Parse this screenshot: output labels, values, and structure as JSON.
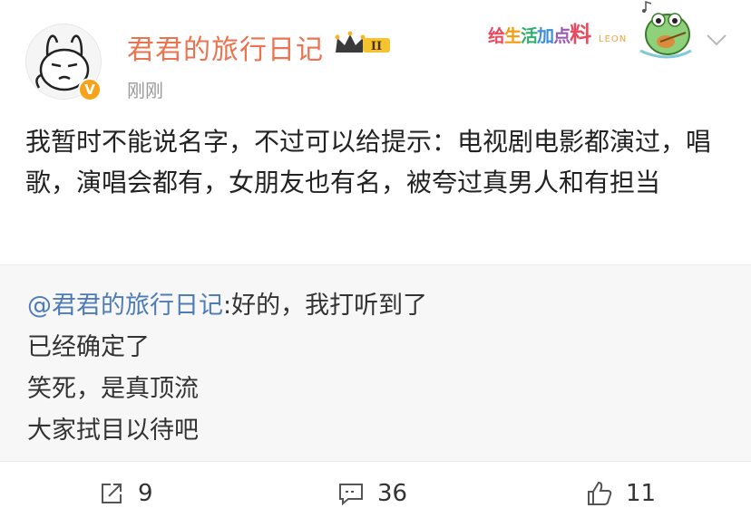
{
  "post": {
    "author": "君君的旅行日记",
    "verified_badge": "V",
    "timestamp": "刚刚",
    "text": "我暂时不能说名字，不过可以给提示：电视剧电影都演过，唱歌，演唱会都有，女朋友也有名，被夸过真男人和有担当",
    "colors": {
      "author": "#eb7350",
      "mention": "#4e7cb8",
      "badge": "#f7a21a"
    }
  },
  "sticker": {
    "chars": [
      "给",
      "生",
      "活",
      "加",
      "点",
      "料"
    ],
    "sub": "LEON",
    "icon": "frog-guitar-sticker-icon"
  },
  "quote": {
    "mention": "@君君的旅行日记",
    "first_line_rest": ":好的，我打听到了",
    "lines": [
      "已经确定了",
      "笑死，是真顶流",
      "大家拭目以待吧"
    ]
  },
  "actions": {
    "repost": {
      "icon": "share-icon",
      "count": "9"
    },
    "comment": {
      "icon": "comment-icon",
      "count": "36"
    },
    "like": {
      "icon": "thumbs-up-icon",
      "count": "11"
    }
  }
}
